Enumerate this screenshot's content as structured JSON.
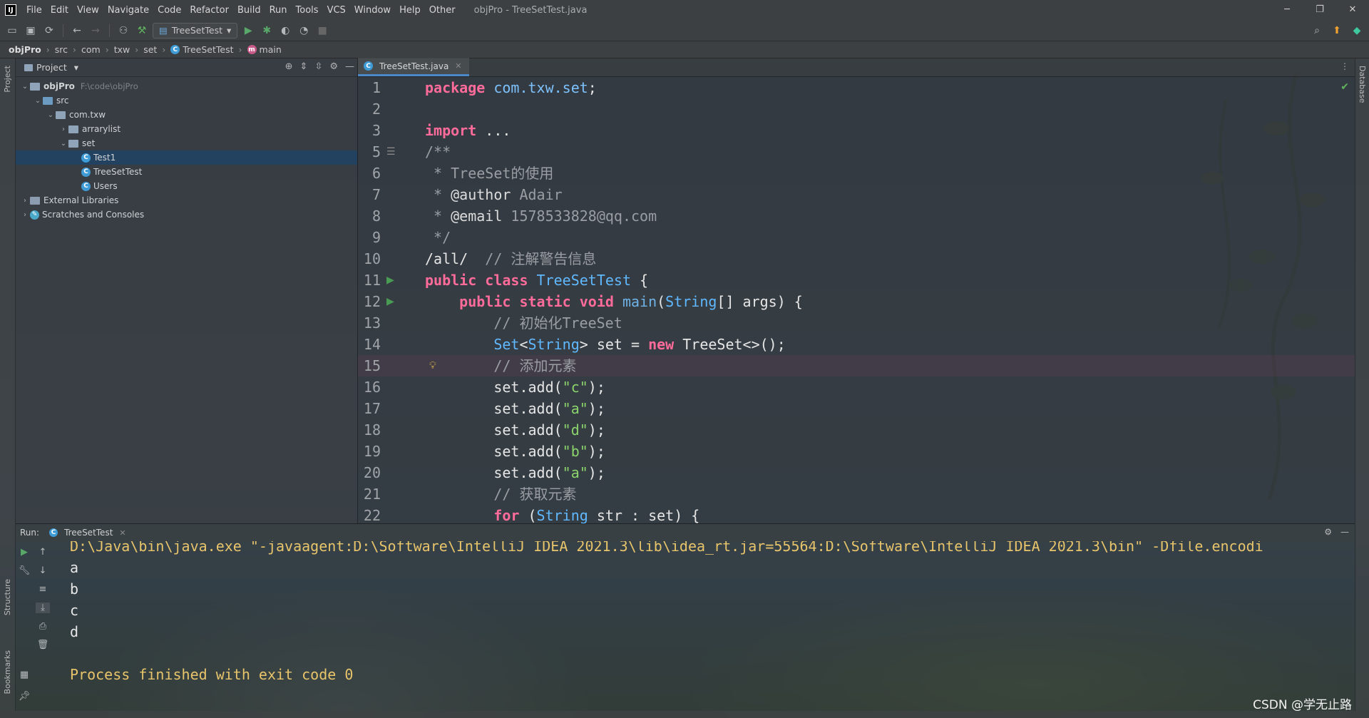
{
  "window": {
    "title": "objPro - TreeSetTest.java",
    "menu": [
      "File",
      "Edit",
      "View",
      "Navigate",
      "Code",
      "Refactor",
      "Build",
      "Run",
      "Tools",
      "VCS",
      "Window",
      "Help",
      "Other"
    ],
    "controls": [
      "─",
      "❐",
      "✕"
    ]
  },
  "toolbar": {
    "run_config": "TreeSetTest"
  },
  "breadcrumb": [
    "objPro",
    "src",
    "com",
    "txw",
    "set",
    "TreeSetTest",
    "main"
  ],
  "project_panel": {
    "title": "Project",
    "tree": [
      {
        "label": "objPro",
        "hint": "F:\\code\\objPro",
        "depth": 0,
        "expanded": true,
        "kind": "module"
      },
      {
        "label": "src",
        "depth": 1,
        "expanded": true,
        "kind": "source-folder"
      },
      {
        "label": "com.txw",
        "depth": 2,
        "expanded": true,
        "kind": "package"
      },
      {
        "label": "arrarylist",
        "depth": 3,
        "expanded": false,
        "kind": "package"
      },
      {
        "label": "set",
        "depth": 3,
        "expanded": true,
        "kind": "package"
      },
      {
        "label": "Test1",
        "depth": 4,
        "kind": "class",
        "selected": true
      },
      {
        "label": "TreeSetTest",
        "depth": 4,
        "kind": "class"
      },
      {
        "label": "Users",
        "depth": 4,
        "kind": "class"
      },
      {
        "label": "External Libraries",
        "depth": 0,
        "expanded": false,
        "kind": "library"
      },
      {
        "label": "Scratches and Consoles",
        "depth": 0,
        "expanded": false,
        "kind": "scratch"
      }
    ]
  },
  "editor": {
    "tab": "TreeSetTest.java",
    "lines": [
      {
        "n": "1",
        "segs": [
          [
            "kw",
            "package "
          ],
          [
            "pkg",
            "com.txw.set"
          ],
          [
            "",
            ";"
          ]
        ]
      },
      {
        "n": "2",
        "segs": []
      },
      {
        "n": "3",
        "segs": [
          [
            "kw",
            "import "
          ],
          [
            "",
            "..."
          ]
        ]
      },
      {
        "n": "5",
        "segs": [
          [
            "cmt",
            "/**"
          ]
        ]
      },
      {
        "n": "6",
        "segs": [
          [
            "cmt",
            " * TreeSet的使用"
          ]
        ]
      },
      {
        "n": "7",
        "segs": [
          [
            "cmt",
            " * "
          ],
          [
            "doc-tag",
            "@author"
          ],
          [
            "cmt",
            " Adair"
          ]
        ]
      },
      {
        "n": "8",
        "segs": [
          [
            "cmt",
            " * "
          ],
          [
            "doc-tag",
            "@email"
          ],
          [
            "cmt",
            " 1578533828@qq.com"
          ]
        ]
      },
      {
        "n": "9",
        "segs": [
          [
            "cmt",
            " */"
          ]
        ]
      },
      {
        "n": "10",
        "segs": [
          [
            "",
            "/all/  "
          ],
          [
            "cmt",
            "// 注解警告信息"
          ]
        ]
      },
      {
        "n": "11",
        "segs": [
          [
            "kw",
            "public class "
          ],
          [
            "type",
            "TreeSetTest"
          ],
          [
            "",
            " {"
          ]
        ]
      },
      {
        "n": "12",
        "segs": [
          [
            "",
            "    "
          ],
          [
            "kw",
            "public static void "
          ],
          [
            "meth",
            "main"
          ],
          [
            "",
            "("
          ],
          [
            "type",
            "String"
          ],
          [
            "",
            "[] args) {"
          ]
        ]
      },
      {
        "n": "13",
        "segs": [
          [
            "",
            "        "
          ],
          [
            "cmt",
            "// 初始化TreeSet"
          ]
        ]
      },
      {
        "n": "14",
        "segs": [
          [
            "",
            "        "
          ],
          [
            "type",
            "Set"
          ],
          [
            "",
            "<"
          ],
          [
            "type",
            "String"
          ],
          [
            "",
            "> set = "
          ],
          [
            "kw",
            "new "
          ],
          [
            "",
            "TreeSet<>();"
          ]
        ]
      },
      {
        "n": "15",
        "segs": [
          [
            "",
            "        "
          ],
          [
            "cmt",
            "// 添加元素"
          ]
        ]
      },
      {
        "n": "16",
        "segs": [
          [
            "",
            "        set.add("
          ],
          [
            "str",
            "\"c\""
          ],
          [
            "",
            ");"
          ]
        ]
      },
      {
        "n": "17",
        "segs": [
          [
            "",
            "        set.add("
          ],
          [
            "str",
            "\"a\""
          ],
          [
            "",
            ");"
          ]
        ]
      },
      {
        "n": "18",
        "segs": [
          [
            "",
            "        set.add("
          ],
          [
            "str",
            "\"d\""
          ],
          [
            "",
            ");"
          ]
        ]
      },
      {
        "n": "19",
        "segs": [
          [
            "",
            "        set.add("
          ],
          [
            "str",
            "\"b\""
          ],
          [
            "",
            ");"
          ]
        ]
      },
      {
        "n": "20",
        "segs": [
          [
            "",
            "        set.add("
          ],
          [
            "str",
            "\"a\""
          ],
          [
            "",
            ");"
          ]
        ]
      },
      {
        "n": "21",
        "segs": [
          [
            "",
            "        "
          ],
          [
            "cmt",
            "// 获取元素"
          ]
        ]
      },
      {
        "n": "22",
        "segs": [
          [
            "",
            "        "
          ],
          [
            "kw",
            "for "
          ],
          [
            "",
            "("
          ],
          [
            "type",
            "String"
          ],
          [
            "",
            " str : set) {"
          ]
        ]
      }
    ],
    "run_gutter_lines": [
      "11",
      "12"
    ],
    "current_line": "15"
  },
  "run_panel": {
    "label": "Run:",
    "tab": "TreeSetTest",
    "command": "D:\\Java\\bin\\java.exe \"-javaagent:D:\\Software\\IntelliJ IDEA 2021.3\\lib\\idea_rt.jar=55564:D:\\Software\\IntelliJ IDEA 2021.3\\bin\" -Dfile.encodi",
    "output": [
      "a",
      "b",
      "c",
      "d",
      ""
    ],
    "exit": "Process finished with exit code 0"
  },
  "side_labels": {
    "project": "Project",
    "structure": "Structure",
    "bookmarks": "Bookmarks",
    "database": "Database"
  },
  "watermark": "CSDN @学无止路",
  "colors": {
    "keyword": "#ff6b9a",
    "string": "#8bd46c",
    "comment": "#9a9ea3",
    "type": "#60b8ff",
    "console_highlight": "#e8c46a",
    "selection": "#214264"
  }
}
